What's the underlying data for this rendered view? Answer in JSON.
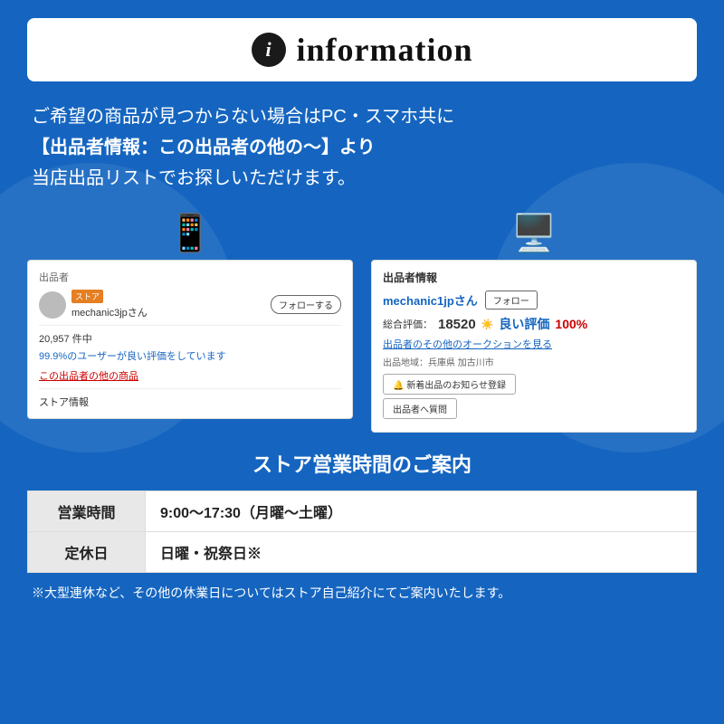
{
  "header": {
    "icon_label": "i",
    "title": "information"
  },
  "description": {
    "line1": "ご希望の商品が見つからない場合はPC・スマホ共に",
    "line2": "【出品者情報：この出品者の他の〜】より",
    "line3": "当店出品リストでお探しいただけます。"
  },
  "mobile_screenshot": {
    "header": "出品者",
    "store_badge": "ストア",
    "seller_name": "mechanic3jpさん",
    "follow_btn": "フォローする",
    "count": "20,957 件中",
    "rating": "99.9%のユーザーが良い評価をしています",
    "link": "この出品者の他の商品",
    "store_info": "ストア情報"
  },
  "pc_screenshot": {
    "header": "出品者情報",
    "seller_name": "mechanic1jpさん",
    "follow_btn": "フォロー",
    "rating_label": "総合評価：",
    "rating_num": "18520",
    "good_label": "良い評価",
    "good_percent": "100%",
    "link": "出品者のその他のオークションを見る",
    "location": "出品地域：兵庫県 加古川市",
    "btn1": "🔔 新着出品のお知らせ登録",
    "btn2": "出品者へ質問"
  },
  "store_hours": {
    "section_title": "ストア営業時間のご案内",
    "rows": [
      {
        "label": "営業時間",
        "value": "9:00〜17:30（月曜〜土曜）"
      },
      {
        "label": "定休日",
        "value": "日曜・祝祭日※"
      }
    ],
    "footnote": "※大型連休など、その他の休業日についてはストア自己紹介にてご案内いたします。"
  }
}
